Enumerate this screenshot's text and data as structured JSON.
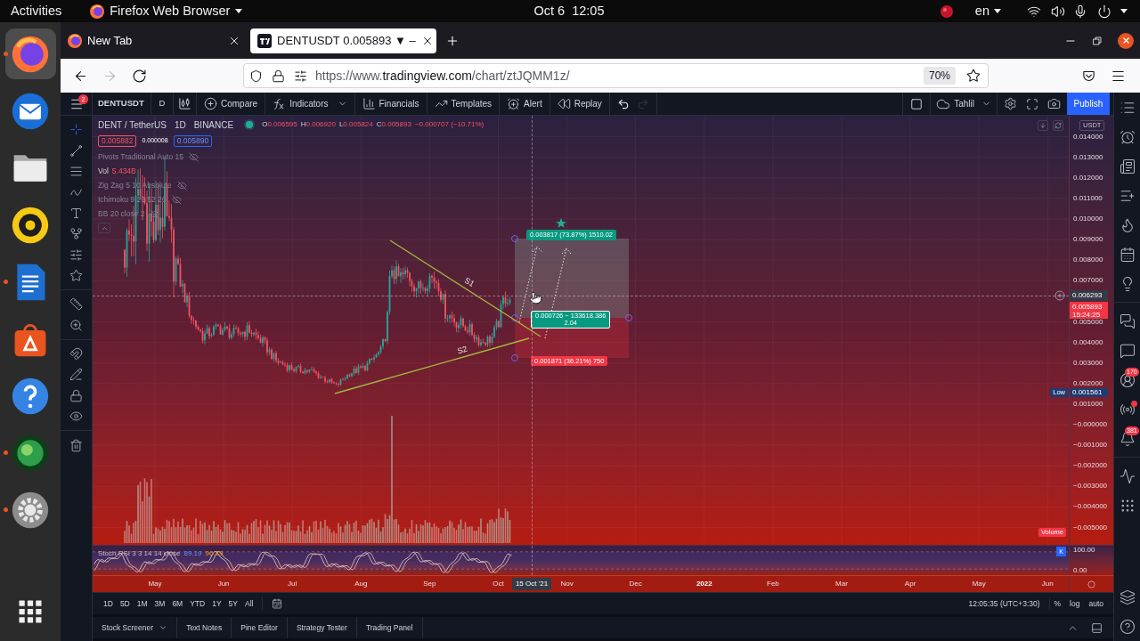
{
  "system_bar": {
    "activities": "Activities",
    "app_menu": "Firefox Web Browser",
    "clock": "Oct 6  12:05",
    "language": "en"
  },
  "dock": [
    {
      "kind": "firefox",
      "selected": true,
      "running": true
    },
    {
      "kind": "mail",
      "selected": false,
      "running": false
    },
    {
      "kind": "files",
      "selected": false,
      "running": false
    },
    {
      "kind": "music",
      "selected": false,
      "running": false
    },
    {
      "kind": "writer",
      "selected": false,
      "running": true
    },
    {
      "kind": "store",
      "selected": false,
      "running": false
    },
    {
      "kind": "help",
      "selected": false,
      "running": false
    },
    {
      "kind": "globe",
      "selected": false,
      "running": true
    },
    {
      "kind": "settings",
      "selected": false,
      "running": true
    },
    {
      "kind": "apps",
      "selected": false,
      "running": false
    }
  ],
  "browser": {
    "tabs": [
      {
        "title": "New Tab",
        "kind": "firefox",
        "selected": false
      },
      {
        "title": "DENTUSDT 0.005893 ▼ –",
        "kind": "tradingview",
        "selected": true
      }
    ],
    "nav": [
      {
        "kind": "back",
        "disabled": false
      },
      {
        "kind": "forward",
        "disabled": true
      },
      {
        "kind": "reload",
        "disabled": false
      }
    ],
    "url": {
      "scheme": "https://www.",
      "domain": "tradingview.com",
      "path": "/chart/ztJQMM1z/"
    },
    "zoom": "70%"
  },
  "chart": {
    "toolbar": {
      "menu_badge": "2",
      "symbol": "DENTUSDT",
      "interval": "D",
      "buttons": [
        {
          "label": "Compare",
          "kind": "compare"
        },
        {
          "label": "Indicators",
          "kind": "indicators"
        },
        {
          "label": "Financials",
          "kind": "financials"
        },
        {
          "label": "Templates",
          "kind": "templates"
        },
        {
          "label": "Alert",
          "kind": "alert"
        },
        {
          "label": "Replay",
          "kind": "replay"
        }
      ],
      "history": [
        {
          "kind": "undo",
          "disabled": false
        },
        {
          "kind": "redo",
          "disabled": true
        }
      ],
      "layout": "Tahlil",
      "publish": "Publish"
    },
    "drawing_tools": [
      [
        {
          "kind": "crosshair",
          "selected": true
        },
        {
          "kind": "line",
          "selected": false
        },
        {
          "kind": "fib",
          "selected": false
        },
        {
          "kind": "brush",
          "selected": false
        },
        {
          "kind": "text",
          "selected": false
        },
        {
          "kind": "pattern",
          "selected": false
        },
        {
          "kind": "forecast",
          "selected": false
        },
        {
          "kind": "star",
          "selected": false
        }
      ],
      [
        {
          "kind": "ruler",
          "selected": false
        },
        {
          "kind": "zoom",
          "selected": false
        }
      ],
      [
        {
          "kind": "magnet",
          "selected": false
        },
        {
          "kind": "draw-lock",
          "selected": false
        },
        {
          "kind": "lock",
          "selected": false
        },
        {
          "kind": "eye",
          "selected": false
        }
      ],
      [
        {
          "kind": "trash",
          "selected": false
        }
      ]
    ],
    "legend": {
      "title": "DENT / TetherUS",
      "interval": "1D",
      "exchange": "BINANCE",
      "ohlc": [
        {
          "key": "O",
          "value": "0.006595"
        },
        {
          "key": "H",
          "value": "0.006920"
        },
        {
          "key": "L",
          "value": "0.005824"
        },
        {
          "key": "C",
          "value": "0.005893"
        }
      ],
      "change": "−0.000707 (−10.71%)",
      "bid": "0.005882",
      "spread": "0.000008",
      "ask": "0.005890"
    },
    "indicators": [
      {
        "name": "Pivots Traditional Auto 15",
        "hidden": true
      },
      {
        "name": "Vol",
        "value": "5.434B",
        "hidden": false
      },
      {
        "name": "Zig Zag 5 10 Absolute",
        "hidden": true
      },
      {
        "name": "Ichimoku 9 26 52 26",
        "hidden": true
      },
      {
        "name": "BB 20 close 2",
        "hidden": true
      }
    ],
    "position": {
      "target": "0.003817 (73.87%) 1510.02",
      "size": "0.000726 ~ 133618.386",
      "ratio": "2.04",
      "stop": "0.001871 (36.21%) 750"
    },
    "trend_labels": [
      "S1",
      "S2"
    ],
    "price_axis": {
      "currency": "USDT",
      "ticks": [
        "0.014000",
        "0.013000",
        "0.012000",
        "0.011000",
        "0.010000",
        "0.009000",
        "0.008000",
        "0.007000",
        "0.005000",
        "0.004000",
        "0.003000",
        "0.002000",
        "0.001000",
        "−0.000000",
        "−0.001000",
        "−0.002000",
        "−0.003000",
        "−0.004000",
        "−0.005000"
      ],
      "crosshair": "0.006293",
      "last": "0.005893",
      "countdown": "15:24:25",
      "low_label": "Low",
      "low": "0.001561",
      "volume_label": "Volume"
    },
    "stoch": {
      "name": "Stoch RSI 3 3 14 14 close",
      "k": "89.19",
      "d": "96.19",
      "ticks": [
        "100.00",
        "0.00"
      ],
      "badge": "K"
    },
    "time_axis": {
      "labels": [
        {
          "text": "May",
          "bold": false
        },
        {
          "text": "Jun",
          "bold": false
        },
        {
          "text": "Jul",
          "bold": false
        },
        {
          "text": "Aug",
          "bold": false
        },
        {
          "text": "Sep",
          "bold": false
        },
        {
          "text": "Oct",
          "bold": false
        },
        {
          "text": "Nov",
          "bold": false
        },
        {
          "text": "Dec",
          "bold": false
        },
        {
          "text": "2022",
          "bold": true
        },
        {
          "text": "Feb",
          "bold": false
        },
        {
          "text": "Mar",
          "bold": false
        },
        {
          "text": "Apr",
          "bold": false
        },
        {
          "text": "May",
          "bold": false
        },
        {
          "text": "Jun",
          "bold": false
        }
      ],
      "crosshair": "15 Oct '21"
    },
    "ranges": [
      "1D",
      "5D",
      "1M",
      "3M",
      "6M",
      "YTD",
      "1Y",
      "5Y",
      "All"
    ],
    "clock": "12:05:35 (UTC+3:30)",
    "scale": [
      "%",
      "log",
      "auto"
    ],
    "panel_tabs": [
      {
        "label": "Stock Screener",
        "dropdown": true
      },
      {
        "label": "Text Notes",
        "dropdown": false
      },
      {
        "label": "Pine Editor",
        "dropdown": false
      },
      {
        "label": "Strategy Tester",
        "dropdown": false
      },
      {
        "label": "Trading Panel",
        "dropdown": false
      }
    ],
    "sidebar": [
      [
        {
          "kind": "list"
        },
        {
          "kind": "alarm"
        },
        {
          "kind": "news"
        },
        {
          "kind": "list-plus"
        },
        {
          "kind": "flame"
        },
        {
          "kind": "calendar"
        },
        {
          "kind": "idea"
        }
      ],
      [
        {
          "kind": "chats"
        },
        {
          "kind": "chat"
        },
        {
          "kind": "avatar",
          "badge": "170"
        },
        {
          "kind": "stream",
          "dot": true
        },
        {
          "kind": "bell",
          "badge": "381"
        }
      ],
      [
        {
          "kind": "zigzag"
        },
        {
          "kind": "dots"
        }
      ]
    ],
    "sidebar_bottom": [
      {
        "kind": "layers"
      },
      {
        "kind": "help"
      }
    ]
  }
}
